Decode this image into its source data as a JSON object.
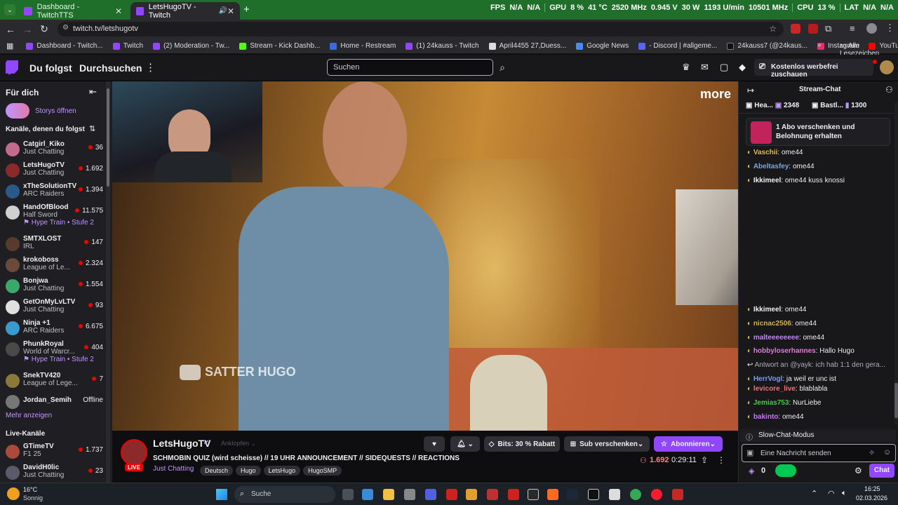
{
  "browser": {
    "tabs": [
      {
        "title": "Dashboard - TwitchTTS",
        "active": false
      },
      {
        "title": "LetsHugoTV - Twitch",
        "active": true
      }
    ],
    "hud": [
      "FPS",
      "N/A",
      "N/A",
      "GPU",
      "8 %",
      "41 °C",
      "2520 MHz",
      "0.945 V",
      "30 W",
      "1193 U/min",
      "10501 MHz",
      "CPU",
      "13 %",
      "LAT",
      "N/A",
      "N/A"
    ],
    "url": "twitch.tv/letshugotv",
    "bookmarks": [
      "Dashboard - Twitch...",
      "Twitch",
      "(2) Moderation - Tw...",
      "Stream - Kick Dashb...",
      "Home - Restream",
      "(1) 24kauss - Twitch",
      "April4455 27,Duess...",
      "Google News",
      "- Discord | #allgeme...",
      "24kauss7 (@24kaus...",
      "Instagram",
      "YouTube"
    ],
    "all_bookmarks": "Alle Lesezeichen"
  },
  "nav": {
    "following": "Du folgst",
    "browse": "Durchsuchen",
    "search_placeholder": "Suchen",
    "adfree": "Kostenlos werbefrei zuschauen"
  },
  "sidebar": {
    "for_you": "Für dich",
    "stories": "Storys öffnen",
    "followed_header": "Kanäle, denen du folgst",
    "channels": [
      {
        "name": "Catgirl_Kiko",
        "game": "Just Chatting",
        "viewers": "36",
        "color": "#c46a8a"
      },
      {
        "name": "LetsHugoTV",
        "game": "Just Chatting",
        "viewers": "1.692",
        "color": "#8a2a2a"
      },
      {
        "name": "xTheSolutionTV",
        "game": "ARC Raiders",
        "viewers": "1.394",
        "color": "#2a5a8a"
      },
      {
        "name": "HandOfBlood",
        "game": "Half Sword",
        "viewers": "11.575",
        "color": "#d0d0d0",
        "hype": "Hype Train • Stufe 2"
      },
      {
        "name": "SMTXLOST",
        "game": "IRL",
        "viewers": "147",
        "color": "#5a3a2a"
      },
      {
        "name": "krokoboss",
        "game": "League of Le...",
        "viewers": "2.324",
        "color": "#6a4a3a"
      },
      {
        "name": "Bonjwa",
        "game": "Just Chatting",
        "viewers": "1.554",
        "color": "#3aa86a"
      },
      {
        "name": "GetOnMyLvLTV",
        "game": "Just Chatting",
        "viewers": "93",
        "color": "#e0e0e0"
      },
      {
        "name": "Ninja +1",
        "game": "ARC Raiders",
        "viewers": "6.675",
        "color": "#3a9ad0"
      },
      {
        "name": "PhunkRoyal",
        "game": "World of Warcr...",
        "viewers": "404",
        "color": "#4a4a4a",
        "hype": "Hype Train • Stufe 2"
      },
      {
        "name": "SnekTV420",
        "game": "League of Lege...",
        "viewers": "7",
        "color": "#8a7a3a"
      },
      {
        "name": "Jordan_Semih",
        "game": "",
        "viewers": "Offline",
        "color": "#777"
      }
    ],
    "show_more": "Mehr anzeigen",
    "live_header": "Live-Kanäle",
    "live_channels": [
      {
        "name": "GTimeTV",
        "game": "F1 25",
        "viewers": "1.737",
        "color": "#aa4a3a"
      },
      {
        "name": "DavidH0lic",
        "game": "Just Chatting",
        "viewers": "23",
        "color": "#5a5a6a"
      }
    ]
  },
  "video": {
    "watermark": "SATTER HUGO",
    "corner_logo": "more"
  },
  "stream": {
    "channel": "LetsHugoTV",
    "knock": "Anklopfen",
    "live_badge": "LIVE",
    "title": "SCHMOBIN QUIZ (wird scheisse) // 19 UHR ANNOUNCEMENT // SIDEQUESTS // REACTIONS",
    "category": "Just Chatting",
    "tags": [
      "Deutsch",
      "Hugo",
      "LetsHugo",
      "HugoSMP"
    ],
    "bits": "Bits: 30 % Rabatt",
    "gift": "Sub verschenken",
    "subscribe": "Abonnieren",
    "viewers": "1.692",
    "uptime": "0:29:11"
  },
  "chat": {
    "header": "Stream-Chat",
    "leaders": [
      {
        "name": "Hea...",
        "value": "2348"
      },
      {
        "name": "Bastl...",
        "value": "1300"
      }
    ],
    "gift_banner": "1 Abo verschenken und Belohnung erhalten",
    "messages_top": [
      {
        "user": "Vaschii",
        "text": "ome44",
        "color": "#e0b84a"
      },
      {
        "user": "Abeltasfey",
        "text": "ome44",
        "color": "#7aa8d8"
      },
      {
        "user": "Ikkimeel",
        "text": "ome44 kuss knossi",
        "color": "#efeff1"
      }
    ],
    "messages_bottom": [
      {
        "user": "Ikkimeel",
        "text": "ome44",
        "color": "#efeff1"
      },
      {
        "user": "nicnac2506",
        "text": "ome44",
        "color": "#d8b04a"
      },
      {
        "user": "malteeeeeeee",
        "text": "ome44",
        "color": "#c080ff"
      },
      {
        "user": "hobbyloserhannes",
        "text": "Hallo Hugo",
        "color": "#e07ad8"
      },
      {
        "user": "",
        "text": "Antwort an @yayk: ich hab 1:1 den gera...",
        "color": "#adadb8"
      },
      {
        "user": "HerrVogl",
        "text": "ja weil er unc ist",
        "color": "#7a9aff"
      },
      {
        "user": "levicore_live",
        "text": "blablabla",
        "color": "#ff6a6a"
      },
      {
        "user": "Jemias753",
        "text": "NurLiebe",
        "color": "#4ac84a"
      },
      {
        "user": "bakinto",
        "text": "ome44",
        "color": "#d070ff"
      }
    ],
    "slow_mode": "Slow-Chat-Modus",
    "input_placeholder": "Eine Nachricht senden",
    "points": "0",
    "send": "Chat"
  },
  "taskbar": {
    "weather_temp": "16°C",
    "weather_desc": "Sonnig",
    "search": "Suche",
    "time": "16:25",
    "date": "02.03.2026"
  }
}
